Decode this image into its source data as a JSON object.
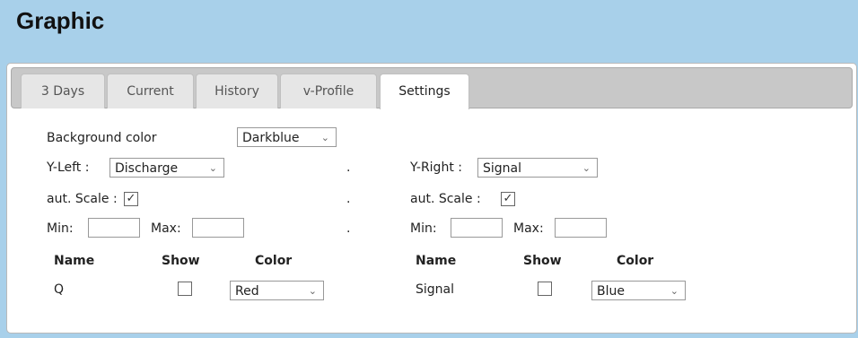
{
  "page": {
    "title": "Graphic"
  },
  "tabs": [
    {
      "label": "3 Days"
    },
    {
      "label": "Current"
    },
    {
      "label": "History"
    },
    {
      "label": "v-Profile"
    },
    {
      "label": "Settings",
      "active": true
    }
  ],
  "settings": {
    "background_label": "Background color",
    "background_value": "Darkblue",
    "dot": ".",
    "left": {
      "axis_label": "Y-Left :",
      "axis_value": "Discharge",
      "autoscale_label": "aut. Scale :",
      "autoscale_checked": true,
      "min_label": "Min:",
      "max_label": "Max:",
      "min_value": "",
      "max_value": ""
    },
    "right": {
      "axis_label": "Y-Right :",
      "axis_value": "Signal",
      "autoscale_label": "aut. Scale :",
      "autoscale_checked": true,
      "min_label": "Min:",
      "max_label": "Max:",
      "min_value": "",
      "max_value": ""
    },
    "columns": {
      "name": "Name",
      "show": "Show",
      "color": "Color"
    },
    "left_series": {
      "name": "Q",
      "show": false,
      "color": "Red"
    },
    "right_series": {
      "name": "Signal",
      "show": false,
      "color": "Blue"
    }
  },
  "icons": {
    "chevron": "chevron-down-icon",
    "check": "checkmark-icon"
  },
  "colors": {
    "header_bg": "#a8d0ea",
    "tabbar_bg": "#c8c8c8",
    "panel_bg": "#ffffff"
  }
}
